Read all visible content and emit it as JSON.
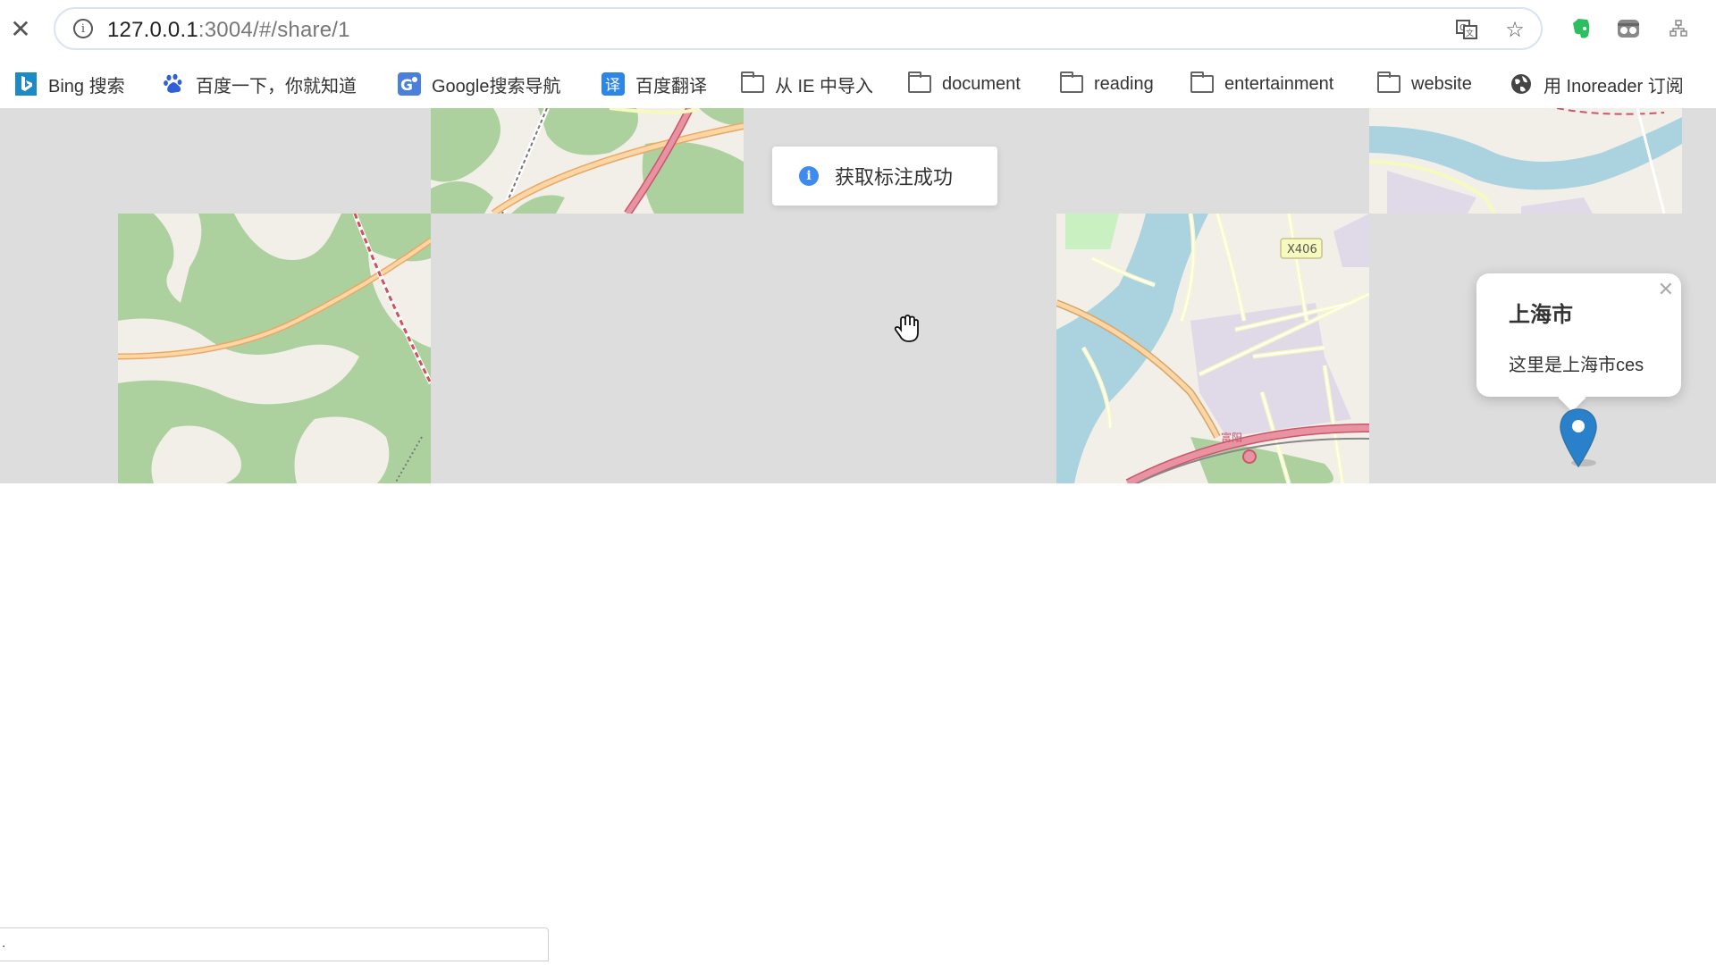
{
  "browser": {
    "close_icon": "close-icon",
    "url_host": "127.0.0.1",
    "url_rest": ":3004/#/share/1",
    "icons": [
      "info-icon",
      "translate-icon",
      "star-icon",
      "evernote-icon",
      "incognito-icon",
      "extension-icon"
    ]
  },
  "bookmarks": [
    {
      "label": "Bing 搜索",
      "icon": "bing-icon"
    },
    {
      "label": "百度一下，你就知道",
      "icon": "baidu-icon"
    },
    {
      "label": "Google搜索导航",
      "icon": "google-nav-icon"
    },
    {
      "label": "百度翻译",
      "icon": "translate-icon"
    },
    {
      "label": "从 IE 中导入",
      "icon": "folder-icon"
    },
    {
      "label": "document",
      "icon": "folder-icon"
    },
    {
      "label": "reading",
      "icon": "folder-icon"
    },
    {
      "label": "entertainment",
      "icon": "folder-icon"
    },
    {
      "label": "website",
      "icon": "folder-icon"
    },
    {
      "label": "用 Inoreader 订阅",
      "icon": "globe-icon"
    }
  ],
  "map": {
    "road_label": "X406",
    "place_label": "富阳",
    "toast": "获取标注成功",
    "popup": {
      "title": "上海市",
      "body": "这里是上海市ces"
    },
    "colors": {
      "water": "#aad3df",
      "forest": "#add19e",
      "land": "#f2efe9",
      "road": "#f7fabf",
      "primary_road": "#fcd6a4",
      "motorway": "#e892a2",
      "residential": "#e0dae8",
      "marker": "#2a81cb"
    }
  },
  "status": {
    "text": "."
  }
}
